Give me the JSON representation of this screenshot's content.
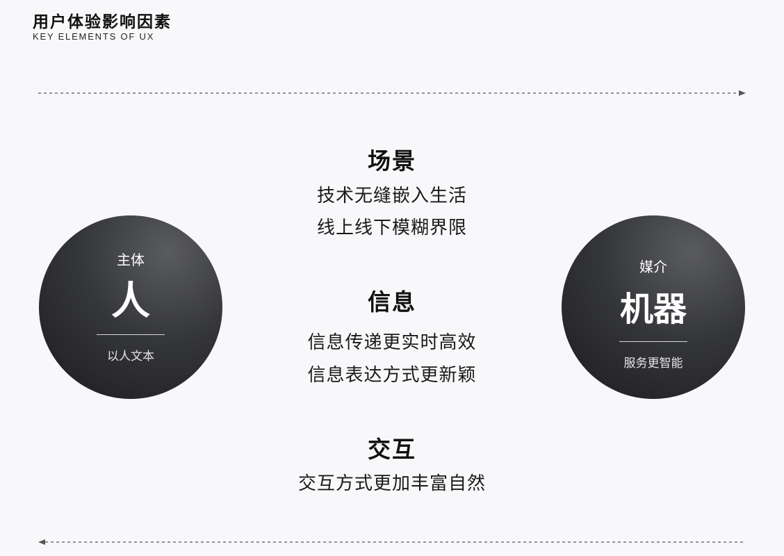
{
  "header": {
    "title": "用户体验影响因素",
    "subtitle": "KEY ELEMENTS OF UX"
  },
  "left_circle": {
    "top_label": "主体",
    "big_label": "人",
    "bottom_label": "以人文本"
  },
  "right_circle": {
    "top_label": "媒介",
    "big_label": "机器",
    "bottom_label": "服务更智能"
  },
  "sections": [
    {
      "heading": "场景",
      "lines": [
        "技术无缝嵌入生活",
        "线上线下模糊界限"
      ]
    },
    {
      "heading": "信息",
      "lines": [
        "信息传递更实时高效",
        "信息表达方式更新颖"
      ]
    },
    {
      "heading": "交互",
      "lines": [
        "交互方式更加丰富自然"
      ]
    }
  ],
  "colors": {
    "background": "#f8f8fa",
    "circle_dark": "#1c1c1f",
    "circle_light": "#5a5b5f",
    "arrow": "#555555"
  }
}
